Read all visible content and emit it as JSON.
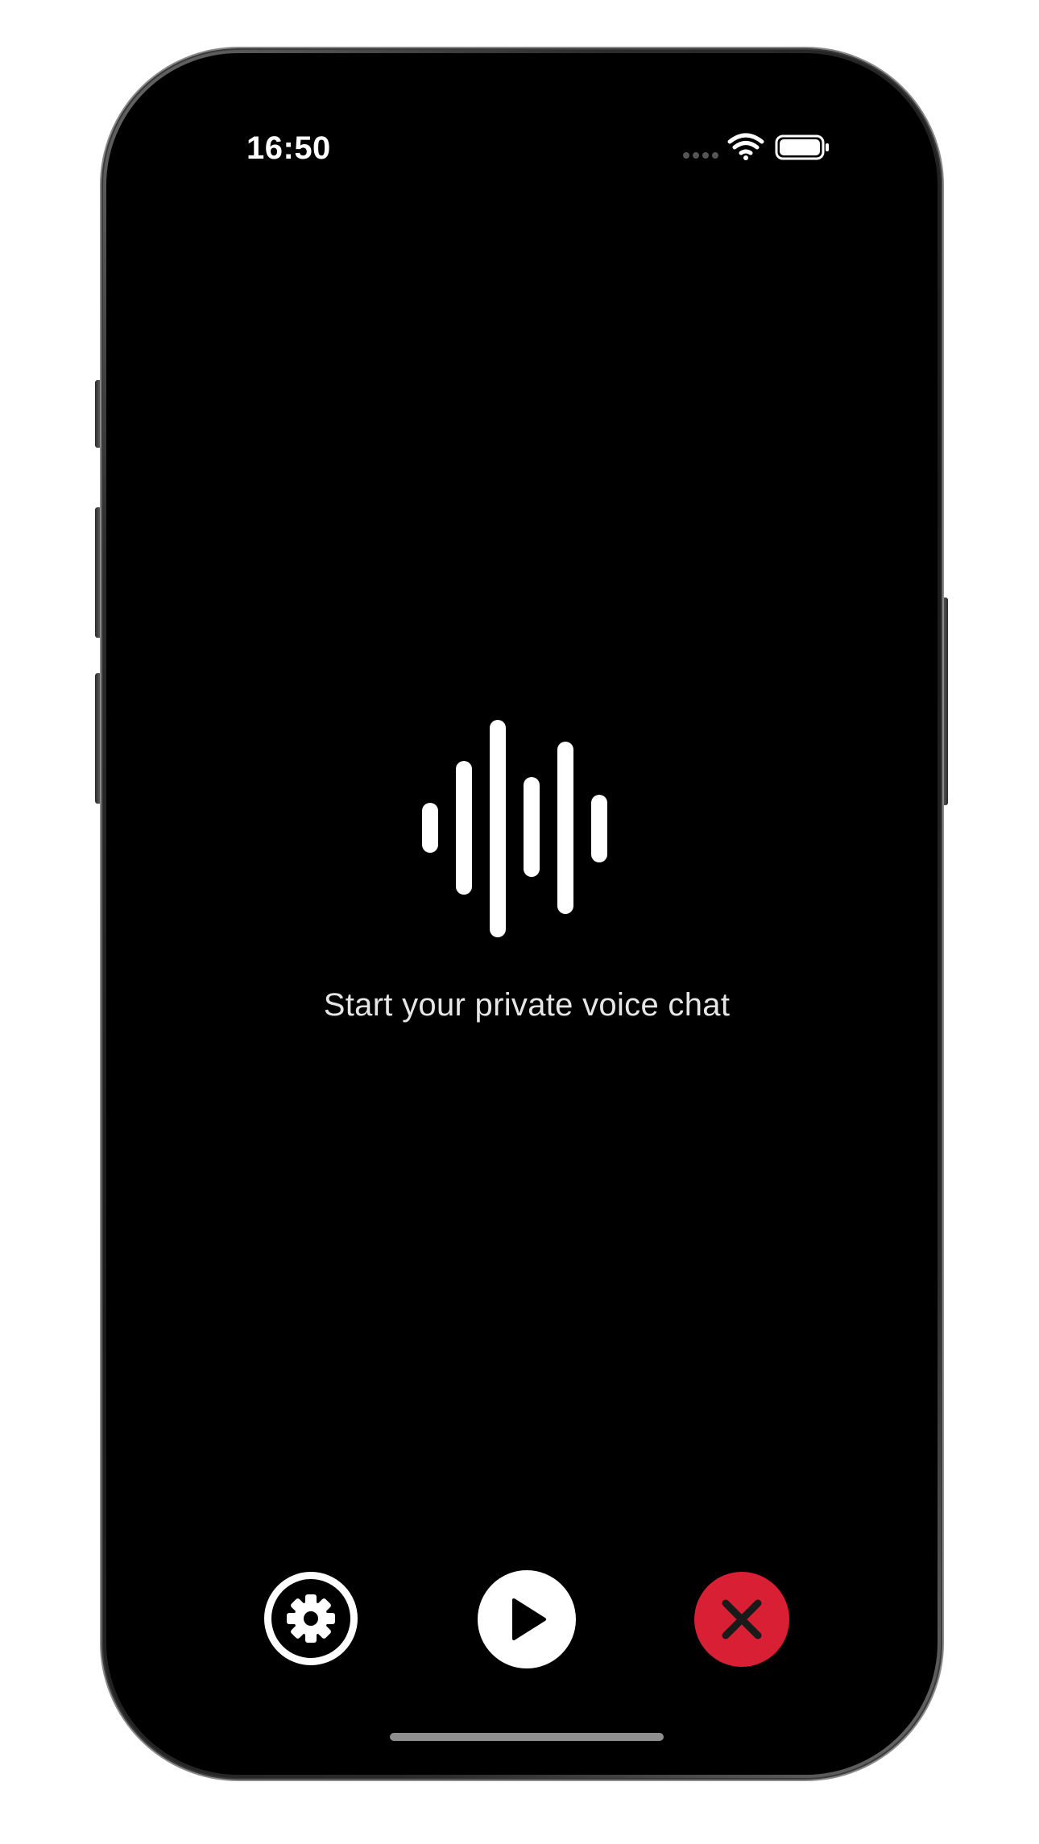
{
  "status_bar": {
    "time": "16:50",
    "signal_icon": "cellular-dots-icon",
    "wifi_icon": "wifi-icon",
    "battery_icon": "battery-icon"
  },
  "main": {
    "waveform_icon": "waveform-icon",
    "prompt": "Start your private voice chat"
  },
  "controls": {
    "settings_icon": "gear-icon",
    "play_icon": "play-icon",
    "close_icon": "close-icon"
  },
  "colors": {
    "background": "#000000",
    "foreground": "#ffffff",
    "close_button": "#d81f34"
  }
}
